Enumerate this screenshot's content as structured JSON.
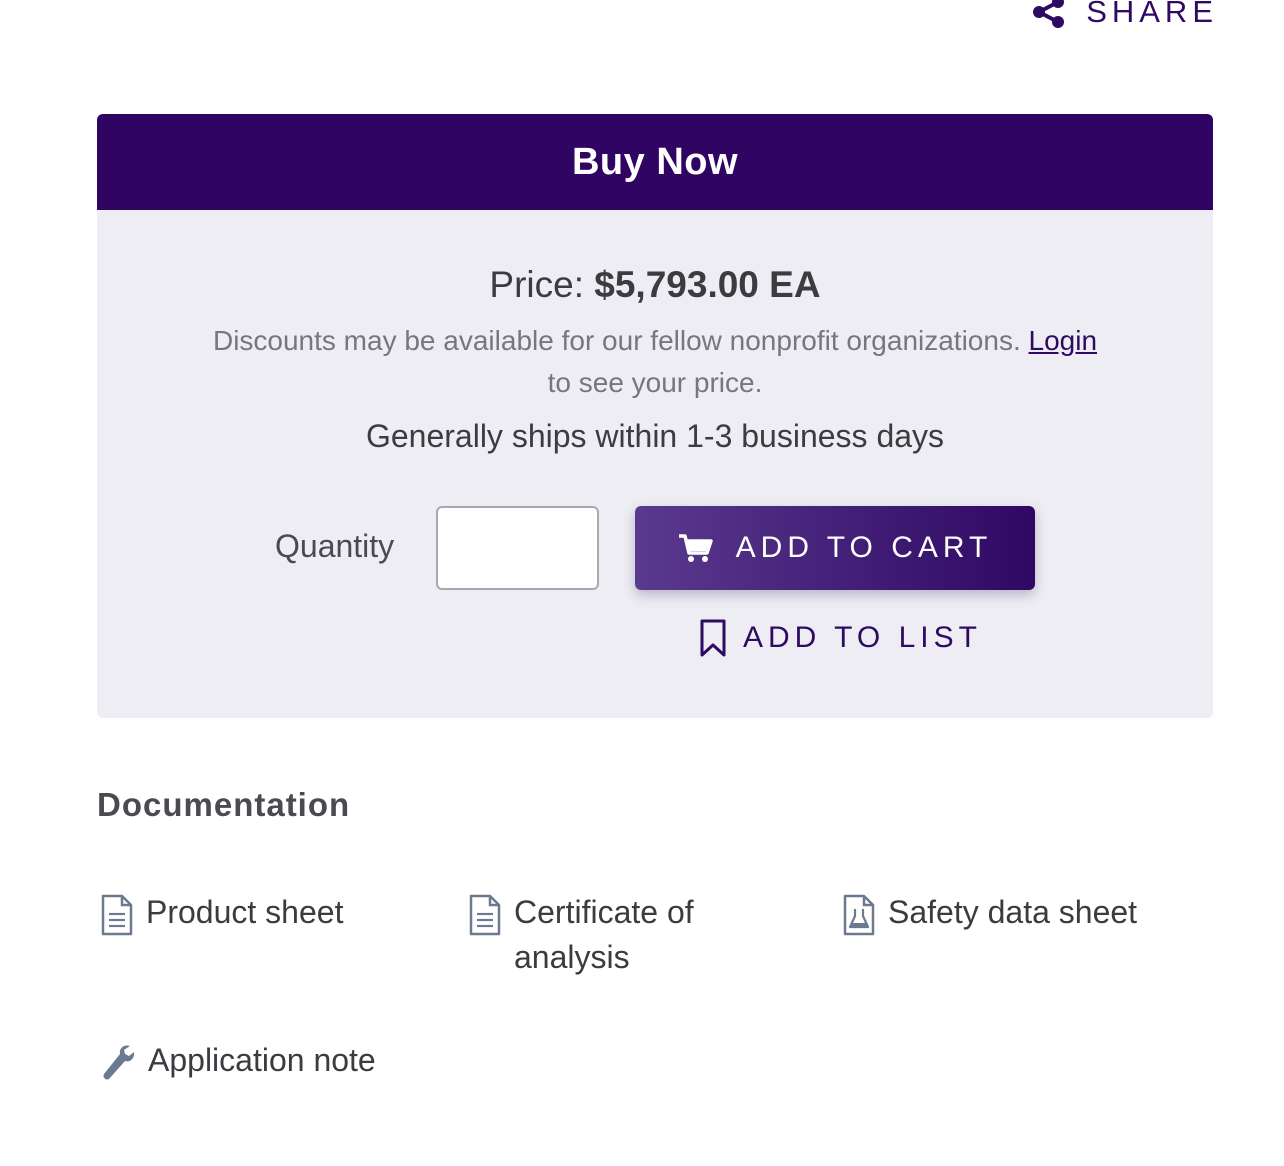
{
  "share": {
    "label": "SHARE",
    "icon": "share-icon"
  },
  "buy_panel": {
    "title": "Buy Now",
    "price_label": "Price:",
    "price_value": "$5,793.00 EA",
    "discount_text": "Discounts may be available for our fellow nonprofit organizations.",
    "login_label": "Login",
    "discount_suffix": "to see your price.",
    "shipping_text": "Generally ships within 1-3 business days",
    "quantity_label": "Quantity",
    "quantity_value": "",
    "add_to_cart_label": "ADD TO CART",
    "add_to_cart_icon": "cart-icon",
    "add_to_list_label": "ADD TO LIST",
    "add_to_list_icon": "bookmark-icon"
  },
  "documentation": {
    "heading": "Documentation",
    "items": [
      {
        "label": "Product sheet",
        "icon": "document-icon"
      },
      {
        "label": "Certificate of analysis",
        "icon": "document-icon"
      },
      {
        "label": "Safety data sheet",
        "icon": "flask-document-icon"
      },
      {
        "label": "Application note",
        "icon": "wrench-icon"
      }
    ]
  },
  "colors": {
    "brand_purple": "#300462",
    "panel_bg": "#eeedf3",
    "link_purple": "#2e0a63",
    "icon_gray": "#6b7a90"
  }
}
